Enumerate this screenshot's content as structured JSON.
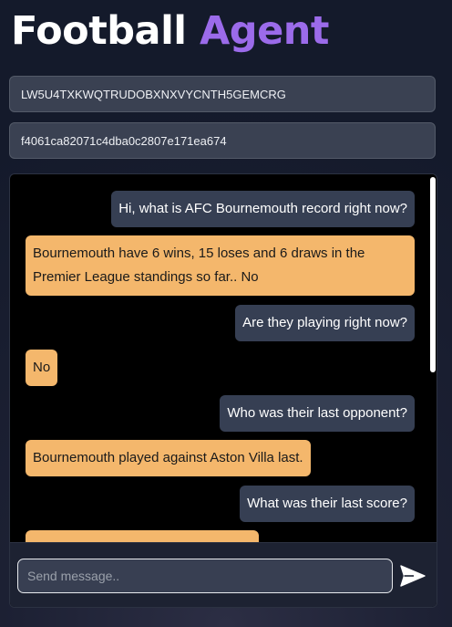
{
  "header": {
    "title_word_1": "Football",
    "title_word_2": "Agent"
  },
  "credentials": {
    "field_1_value": "LW5U4TXKWQTRUDOBXNXVYCNTH5GEMCRG",
    "field_2_value": "f4061ca82071c4dba0c2807e171ea674"
  },
  "chat": {
    "messages": [
      {
        "role": "user",
        "text": "Hi, what is AFC Bournemouth record right now?"
      },
      {
        "role": "agent",
        "text": "Bournemouth have 6 wins, 15 loses and 6 draws in the Premier League standings so far.. No"
      },
      {
        "role": "user",
        "text": "Are they playing right now?"
      },
      {
        "role": "agent",
        "text": "No"
      },
      {
        "role": "user",
        "text": "Who was their last opponent?"
      },
      {
        "role": "agent",
        "text": "Bournemouth played against Aston Villa last."
      },
      {
        "role": "user",
        "text": "What was their last score?"
      },
      {
        "role": "agent",
        "text": ""
      }
    ],
    "scroll_fraction_visible": 0.53
  },
  "composer": {
    "placeholder": "Send message..",
    "value": "",
    "send_icon": "send-icon"
  },
  "colors": {
    "accent": "#9b6bea",
    "agent_bubble": "#f4b76c",
    "user_bubble": "#363f53"
  }
}
